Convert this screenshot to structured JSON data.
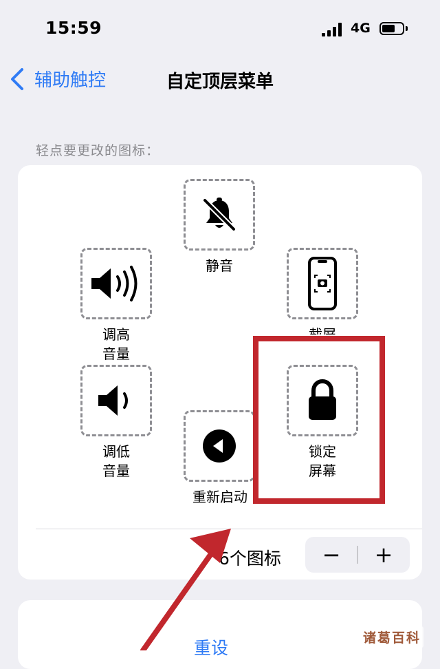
{
  "status_bar": {
    "time": "15:59",
    "network": "4G"
  },
  "nav": {
    "back_label": "辅助触控",
    "title": "自定顶层菜单"
  },
  "section_label": "轻点要更改的图标：",
  "slots": {
    "mute": "静音",
    "volume_up": "调高\n音量",
    "screenshot": "截屏",
    "volume_down": "调低\n音量",
    "restart": "重新启动",
    "lock_screen": "锁定\n屏幕"
  },
  "icon_count": "6个图标",
  "stepper": {
    "minus": "−",
    "plus": "+"
  },
  "reset": "重设",
  "watermark": "诸葛百科",
  "colors": {
    "accent": "#2f7bf5",
    "highlight": "#c1272d"
  },
  "icons": [
    "chevron-left-icon",
    "bell-slash-icon",
    "speaker-high-icon",
    "phone-screenshot-icon",
    "speaker-low-icon",
    "restart-icon",
    "lock-icon"
  ]
}
